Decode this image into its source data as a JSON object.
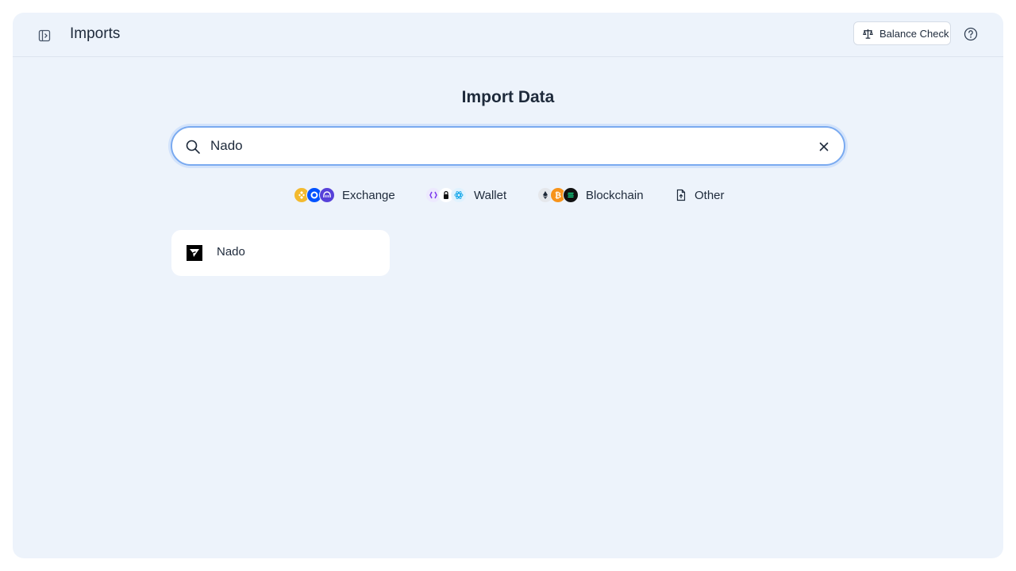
{
  "header": {
    "title": "Imports",
    "sidebar_toggle_icon": "sidebar-toggle-icon",
    "balance_check_label": "Balance Check",
    "balance_check_icon": "scale-icon",
    "help_icon": "help-circle-icon"
  },
  "main": {
    "title": "Import Data",
    "search": {
      "value": "Nado",
      "placeholder": "",
      "icon": "search-icon",
      "clear_icon": "close-icon"
    },
    "categories": [
      {
        "label": "Exchange",
        "icons": [
          "binance-icon",
          "coinbase-icon",
          "kraken-icon"
        ]
      },
      {
        "label": "Wallet",
        "icons": [
          "wallet-icon",
          "ledger-icon",
          "atom-icon"
        ]
      },
      {
        "label": "Blockchain",
        "icons": [
          "ethereum-icon",
          "bitcoin-icon",
          "solana-icon"
        ]
      },
      {
        "label": "Other",
        "icons": [
          "file-upload-icon"
        ]
      }
    ],
    "results": [
      {
        "label": "Nado",
        "icon": "nado-logo-icon"
      }
    ]
  },
  "colors": {
    "panel_bg": "#edf3fb",
    "search_focus_border": "#7aaaf0",
    "text": "#1e2a3b"
  }
}
